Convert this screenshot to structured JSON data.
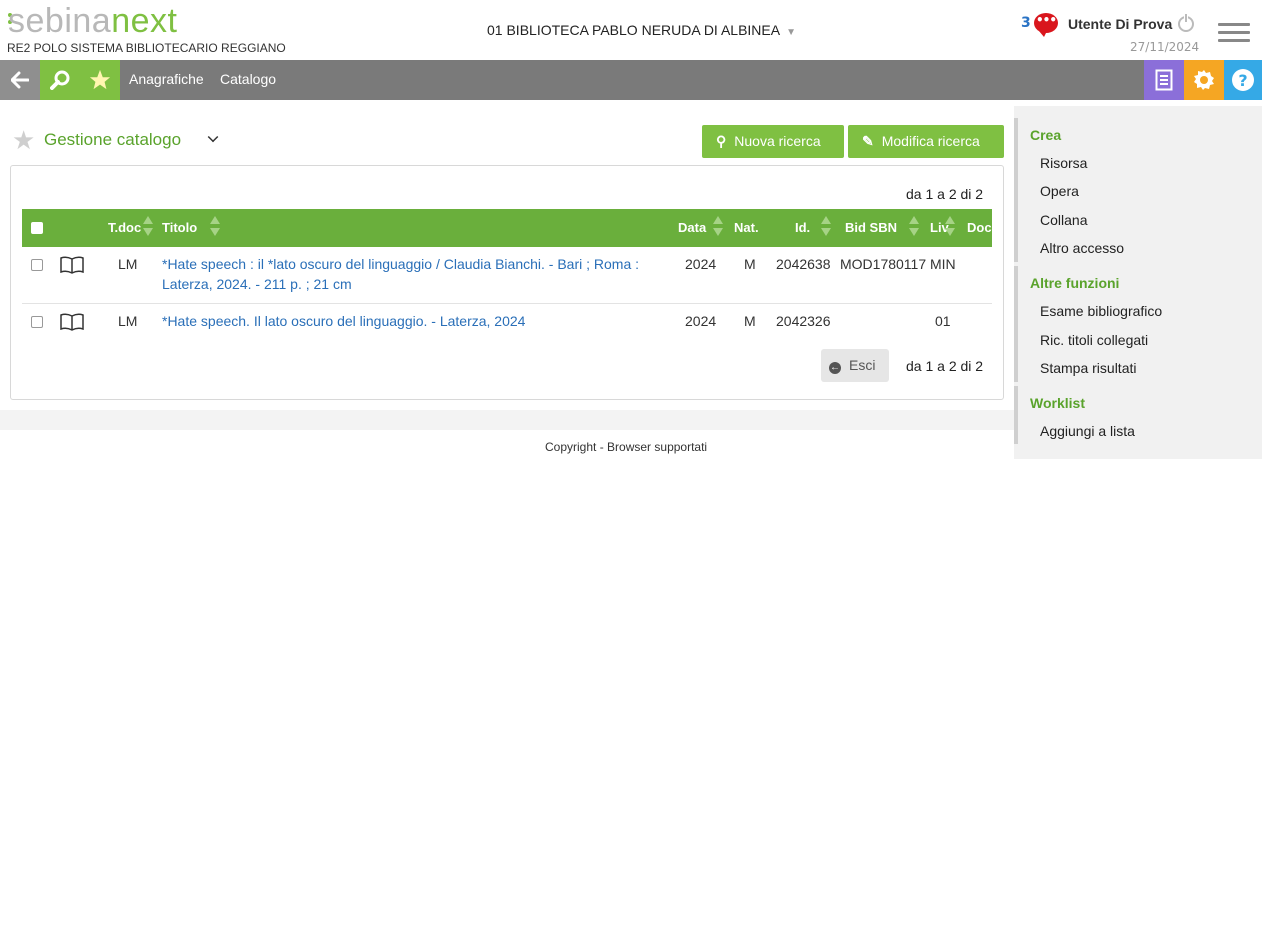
{
  "header": {
    "logo_part1": "sebina",
    "logo_part2": "next",
    "subtitle": "RE2 POLO SISTEMA BIBLIOTECARIO REGGIANO",
    "library": "01 BIBLIOTECA PABLO NERUDA DI ALBINEA",
    "messages_count": "3",
    "messages_icon": "chat-bubble-icon",
    "user": "Utente Di Prova",
    "date": "27/11/2024"
  },
  "nav": {
    "back_icon": "arrow-left-icon",
    "search_icon": "search-icon",
    "favorites_icon": "star-icon",
    "links": [
      "Anagrafiche",
      "Catalogo"
    ],
    "right_icons": [
      "document-icon",
      "gear-icon",
      "help-icon"
    ]
  },
  "page": {
    "title": "Gestione catalogo",
    "new_search": "Nuova ricerca",
    "edit_search": "Modifica ricerca"
  },
  "results": {
    "counter_top": "da 1 a 2 di 2",
    "counter_bottom": "da 1 a 2 di 2",
    "columns": [
      "T.doc",
      "Titolo",
      "Data",
      "Nat.",
      "Id.",
      "Bid SBN",
      "Liv",
      "Doc"
    ],
    "rows": [
      {
        "tdoc": "LM",
        "title": "*Hate speech : il *lato oscuro del linguaggio / Claudia Bianchi. - Bari ; Roma : Laterza, 2024. - 211 p. ; 21 cm",
        "date": "2024",
        "nat": "M",
        "id": "2042638",
        "bid": "MOD1780117",
        "liv": "MIN"
      },
      {
        "tdoc": "LM",
        "title": "*Hate speech. Il lato oscuro del linguaggio. - Laterza, 2024",
        "date": "2024",
        "nat": "M",
        "id": "2042326",
        "bid": "",
        "liv": "01"
      }
    ],
    "exit": "Esci"
  },
  "footer": {
    "copyright": "Copyright",
    "separator": "-",
    "browsers": "Browser supportati"
  },
  "sidebar": {
    "crea": {
      "heading": "Crea",
      "items": [
        "Risorsa",
        "Opera",
        "Collana",
        "Altro accesso"
      ]
    },
    "altre": {
      "heading": "Altre funzioni",
      "items": [
        "Esame bibliografico",
        "Ric. titoli collegati",
        "Stampa risultati"
      ]
    },
    "worklist": {
      "heading": "Worklist",
      "items": [
        "Aggiungi a lista"
      ]
    }
  }
}
